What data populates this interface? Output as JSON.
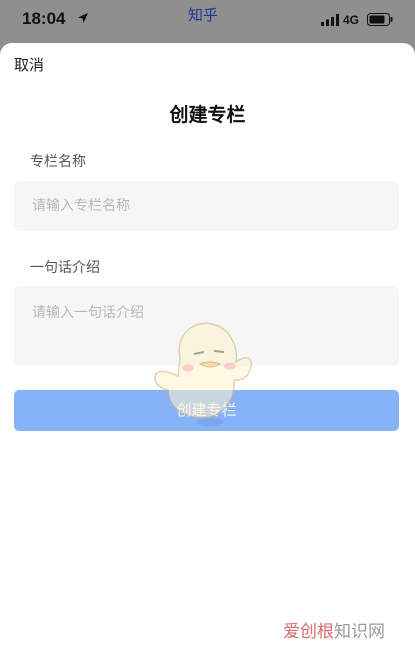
{
  "status_bar": {
    "time": "18:04",
    "app_name": "知乎",
    "network": "4G"
  },
  "sheet": {
    "cancel_label": "取消",
    "title": "创建专栏",
    "name_field": {
      "label": "专栏名称",
      "placeholder": "请输入专栏名称",
      "value": ""
    },
    "intro_field": {
      "label": "一句话介绍",
      "placeholder": "请输入一句话介绍",
      "value": ""
    },
    "submit_label": "创建专栏"
  },
  "watermark": {
    "accent_text": "爱创根",
    "rest_text": "知识网"
  },
  "colors": {
    "submit_button": "#86b3f7",
    "input_background": "#f6f6f6",
    "status_app": "#1a3a9a"
  },
  "icons": [
    "location-arrow-icon",
    "signal-bars-icon",
    "battery-icon",
    "mascot-illustration"
  ]
}
